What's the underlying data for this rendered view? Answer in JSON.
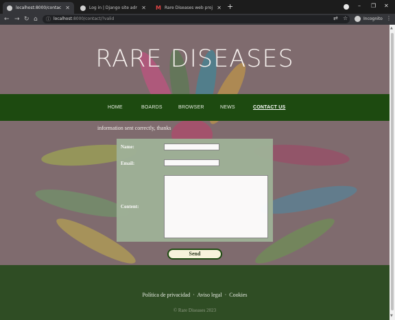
{
  "browser": {
    "tabs": [
      {
        "label": "localhost:8000/contact/?valid",
        "active": true
      },
      {
        "label": "Log in | Django site admin",
        "active": false
      },
      {
        "label": "Rare Diseases web project Djan...",
        "active": false
      }
    ],
    "new_tab": "+",
    "window_controls": {
      "minimize": "–",
      "restore": "❐",
      "close": "✕"
    },
    "url_host": "localhost",
    "url_rest": ":8000/contact/?valid",
    "profile": "Incognito"
  },
  "site": {
    "title": "RARE DISEASES",
    "nav": [
      {
        "label": "HOME",
        "current": false
      },
      {
        "label": "BOARDS",
        "current": false
      },
      {
        "label": "BROWSER",
        "current": false
      },
      {
        "label": "NEWS",
        "current": false
      },
      {
        "label": "CONTACT US",
        "current": true
      }
    ],
    "flash_message": "information sent correctly, thanks",
    "form": {
      "name_label": "Name:",
      "email_label": "Email:",
      "content_label": "Content:",
      "name_value": "",
      "email_value": "",
      "content_value": "",
      "submit_label": "Send"
    },
    "footer": {
      "links": [
        "Política de privacidad",
        "Aviso legal",
        "Cookies"
      ],
      "separator": "·",
      "copyright": "© Rare Diseases 2023"
    }
  },
  "colors": {
    "nav_bg": "#1d4a10",
    "footer_bg": "#2f4d24",
    "form_bg": "#9fb197",
    "page_bg": "#7d6a6d"
  }
}
